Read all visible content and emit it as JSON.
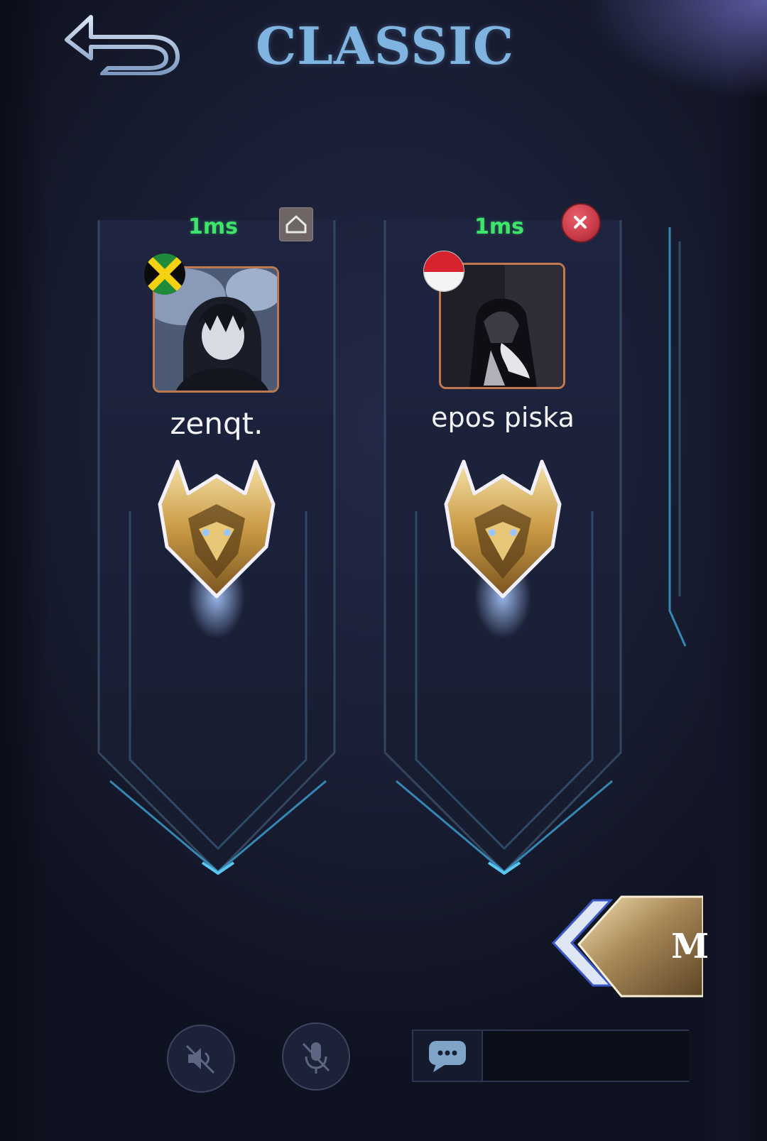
{
  "header": {
    "title": "CLASSIC",
    "back_icon": "back-arrow-icon"
  },
  "players": [
    {
      "ping": "1ms",
      "name": "zenqt.",
      "flag": "jamaica-flag",
      "badge": "host-icon",
      "rank_emblem": "mythic-rank-emblem"
    },
    {
      "ping": "1ms",
      "name": "epos piska",
      "flag": "indonesia-flag",
      "badge": "kick-icon",
      "rank_emblem": "mythic-rank-emblem"
    }
  ],
  "match_button": {
    "label_visible": "M"
  },
  "bottom_bar": {
    "speaker_icon": "speaker-muted-icon",
    "mic_icon": "mic-muted-icon",
    "chat_icon": "chat-bubble-icon",
    "chat_placeholder": ""
  },
  "colors": {
    "title": "#7fb4e0",
    "ping": "#3ee56a",
    "frame_glow": "#3fa3d6",
    "avatar_border": "#c07850",
    "background": "#1b2038"
  }
}
